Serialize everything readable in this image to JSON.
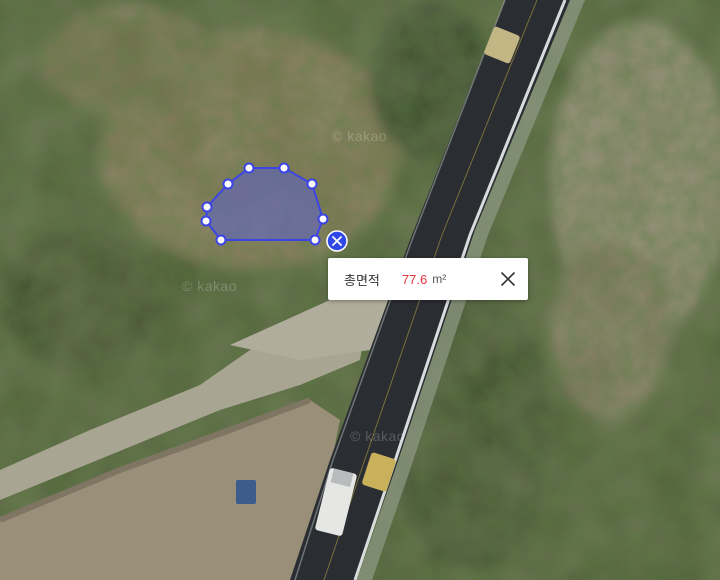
{
  "map": {
    "type": "satellite",
    "watermark_text": "© kakao",
    "colors": {
      "polygon_fill": "#5a5fd6",
      "polygon_stroke": "#3b44e6",
      "vertex_fill": "#ffffff",
      "delete_button": "#2f48e8",
      "road": "#2a2d31",
      "road_line": "#d8dcdc"
    }
  },
  "measurement": {
    "label": "총면적",
    "value": "77.6",
    "unit": "m²",
    "close_icon": "close-icon",
    "delete_icon": "delete-x-icon"
  }
}
